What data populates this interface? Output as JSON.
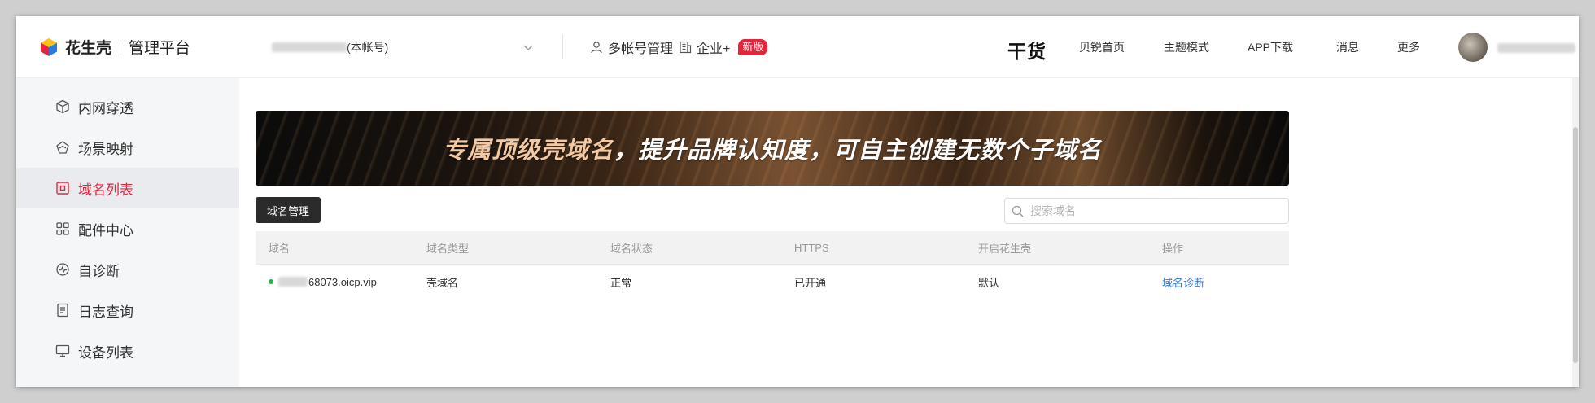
{
  "brand": {
    "name": "花生壳",
    "subtitle": "管理平台"
  },
  "sidebar": {
    "items": [
      {
        "label": "内网穿透",
        "icon": "cube-icon"
      },
      {
        "label": "场景映射",
        "icon": "scene-icon"
      },
      {
        "label": "域名列表",
        "icon": "domain-icon",
        "active": true
      },
      {
        "label": "配件中心",
        "icon": "grid-icon"
      },
      {
        "label": "自诊断",
        "icon": "diagnose-icon"
      },
      {
        "label": "日志查询",
        "icon": "log-icon"
      },
      {
        "label": "设备列表",
        "icon": "monitor-icon"
      }
    ]
  },
  "topbar": {
    "account_suffix": "(本帐号)",
    "multi_account": "多帐号管理",
    "enterprise": "企业+",
    "new_badge": "新版",
    "ganhuo": "干货",
    "menu": [
      "贝锐首页",
      "主题模式",
      "APP下载",
      "消息",
      "更多"
    ]
  },
  "banner": {
    "text_highlight": "专属顶级壳域名",
    "text_rest": "，提升品牌认知度，可自主创建无数个子域名"
  },
  "toolbar": {
    "domain_manage_label": "域名管理",
    "search_placeholder": "搜索域名"
  },
  "table": {
    "headers": [
      "域名",
      "域名类型",
      "域名状态",
      "HTTPS",
      "开启花生壳",
      "操作"
    ],
    "rows": [
      {
        "domain_suffix": "68073.oicp.vip",
        "type": "壳域名",
        "status": "正常",
        "https": "已开通",
        "enabled": "默认",
        "action": "域名诊断"
      }
    ]
  },
  "colors": {
    "accent": "#e6243b",
    "link": "#2a7ae2",
    "status_ok": "#22b14c"
  }
}
